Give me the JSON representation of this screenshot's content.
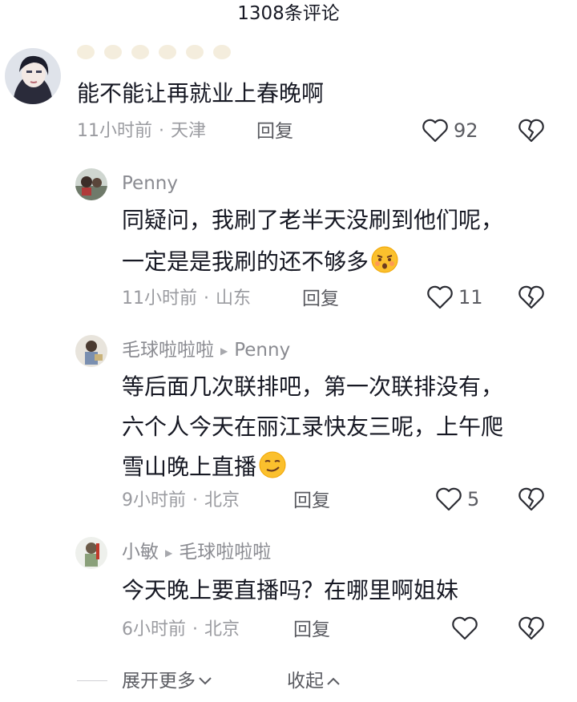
{
  "header": {
    "title": "1308条评论"
  },
  "comments": [
    {
      "name": "",
      "text": [
        "能不能让再就业上春晚啊"
      ],
      "time": "11小时前",
      "location": "天津",
      "reply_label": "回复",
      "likes": "92"
    },
    {
      "name": "Penny",
      "text": [
        "同疑问，我刷了老半天没刷到他们呢，",
        "一定是是我刷的还不够多"
      ],
      "time": "11小时前",
      "location": "山东",
      "reply_label": "回复",
      "likes": "11"
    },
    {
      "name": "毛球啦啦啦",
      "reply_to": "Penny",
      "text": [
        "等后面几次联排吧，第一次联排没有，",
        "六个人今天在丽江录快友三呢，上午爬",
        "雪山晚上直播"
      ],
      "time": "9小时前",
      "location": "北京",
      "reply_label": "回复",
      "likes": "5"
    },
    {
      "name": "小敏",
      "reply_to": "毛球啦啦啦",
      "text": [
        "今天晚上要直播吗？在哪里啊姐妹"
      ],
      "time": "6小时前",
      "location": "北京",
      "reply_label": "回复",
      "likes": ""
    }
  ],
  "footer": {
    "expand_label": "展开更多",
    "collapse_label": "收起"
  },
  "colors": {
    "text": "#161823",
    "meta": "#9a9ba0",
    "name": "#8a8b91"
  }
}
